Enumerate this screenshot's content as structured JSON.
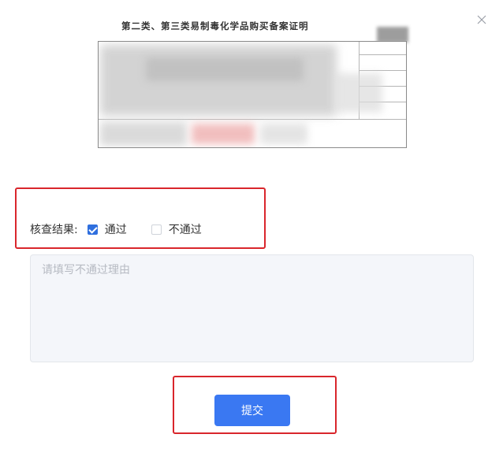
{
  "dialog": {
    "close_icon": "close-icon"
  },
  "certificate": {
    "title": "第二类、第三类易制毒化学品购买备案证明"
  },
  "review": {
    "label": "核查结果:",
    "options": [
      {
        "label": "通过",
        "checked": true
      },
      {
        "label": "不通过",
        "checked": false
      }
    ]
  },
  "reason_input": {
    "value": "",
    "placeholder": "请填写不通过理由"
  },
  "submit": {
    "label": "提交"
  },
  "colors": {
    "primary": "#3a78f2",
    "highlight": "#d9262c",
    "checkbox_checked": "#2f6fde"
  }
}
